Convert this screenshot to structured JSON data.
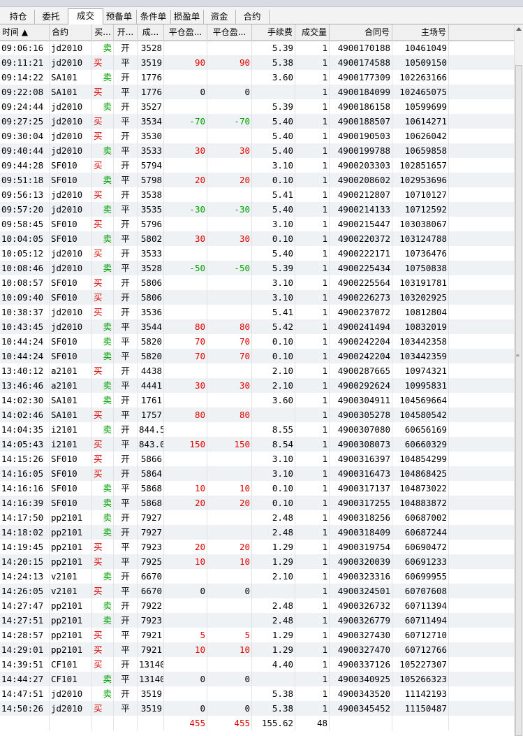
{
  "tabs": [
    "持仓",
    "委托",
    "成交",
    "预备单",
    "条件单",
    "损盈单",
    "资金",
    "合约"
  ],
  "active_tab": "成交",
  "columns": [
    "时间 ▲",
    "合约",
    "买...",
    "开...",
    "成...",
    "平仓盈...",
    "平仓盈...",
    "手续费",
    "成交量",
    "合同号",
    "主场号"
  ],
  "rows": [
    [
      "09:06:16",
      "jd2010",
      "卖",
      "开",
      "3528",
      "",
      "",
      "5.39",
      "1",
      "4900170188",
      "10461049"
    ],
    [
      "09:11:21",
      "jd2010",
      "买",
      "平",
      "3519",
      "90",
      "90",
      "5.38",
      "1",
      "4900174588",
      "10509150"
    ],
    [
      "09:14:22",
      "SA101",
      "卖",
      "开",
      "1776",
      "",
      "",
      "3.60",
      "1",
      "4900177309",
      "102263166"
    ],
    [
      "09:22:08",
      "SA101",
      "买",
      "平",
      "1776",
      "0",
      "0",
      "",
      "1",
      "4900184099",
      "102465075"
    ],
    [
      "09:24:44",
      "jd2010",
      "卖",
      "开",
      "3527",
      "",
      "",
      "5.39",
      "1",
      "4900186158",
      "10599699"
    ],
    [
      "09:27:25",
      "jd2010",
      "买",
      "平",
      "3534",
      "-70",
      "-70",
      "5.40",
      "1",
      "4900188507",
      "10614271"
    ],
    [
      "09:30:04",
      "jd2010",
      "买",
      "开",
      "3530",
      "",
      "",
      "5.40",
      "1",
      "4900190503",
      "10626042"
    ],
    [
      "09:40:44",
      "jd2010",
      "卖",
      "平",
      "3533",
      "30",
      "30",
      "5.40",
      "1",
      "4900199788",
      "10659858"
    ],
    [
      "09:44:28",
      "SF010",
      "买",
      "开",
      "5794",
      "",
      "",
      "3.10",
      "1",
      "4900203303",
      "102851657"
    ],
    [
      "09:51:18",
      "SF010",
      "卖",
      "平",
      "5798",
      "20",
      "20",
      "0.10",
      "1",
      "4900208602",
      "102953696"
    ],
    [
      "09:56:13",
      "jd2010",
      "买",
      "开",
      "3538",
      "",
      "",
      "5.41",
      "1",
      "4900212807",
      "10710127"
    ],
    [
      "09:57:20",
      "jd2010",
      "卖",
      "平",
      "3535",
      "-30",
      "-30",
      "5.40",
      "1",
      "4900214133",
      "10712592"
    ],
    [
      "09:58:45",
      "SF010",
      "买",
      "开",
      "5796",
      "",
      "",
      "3.10",
      "1",
      "4900215447",
      "103038067"
    ],
    [
      "10:04:05",
      "SF010",
      "卖",
      "平",
      "5802",
      "30",
      "30",
      "0.10",
      "1",
      "4900220372",
      "103124788"
    ],
    [
      "10:05:12",
      "jd2010",
      "买",
      "开",
      "3533",
      "",
      "",
      "5.40",
      "1",
      "4900222171",
      "10736476"
    ],
    [
      "10:08:46",
      "jd2010",
      "卖",
      "平",
      "3528",
      "-50",
      "-50",
      "5.39",
      "1",
      "4900225434",
      "10750838"
    ],
    [
      "10:08:57",
      "SF010",
      "买",
      "开",
      "5806",
      "",
      "",
      "3.10",
      "1",
      "4900225564",
      "103191781"
    ],
    [
      "10:09:40",
      "SF010",
      "买",
      "开",
      "5806",
      "",
      "",
      "3.10",
      "1",
      "4900226273",
      "103202925"
    ],
    [
      "10:38:37",
      "jd2010",
      "买",
      "开",
      "3536",
      "",
      "",
      "5.41",
      "1",
      "4900237072",
      "10812804"
    ],
    [
      "10:43:45",
      "jd2010",
      "卖",
      "平",
      "3544",
      "80",
      "80",
      "5.42",
      "1",
      "4900241494",
      "10832019"
    ],
    [
      "10:44:24",
      "SF010",
      "卖",
      "平",
      "5820",
      "70",
      "70",
      "0.10",
      "1",
      "4900242204",
      "103442358"
    ],
    [
      "10:44:24",
      "SF010",
      "卖",
      "平",
      "5820",
      "70",
      "70",
      "0.10",
      "1",
      "4900242204",
      "103442359"
    ],
    [
      "13:40:12",
      "a2101",
      "买",
      "开",
      "4438",
      "",
      "",
      "2.10",
      "1",
      "4900287665",
      "10974321"
    ],
    [
      "13:46:46",
      "a2101",
      "卖",
      "平",
      "4441",
      "30",
      "30",
      "2.10",
      "1",
      "4900292624",
      "10995831"
    ],
    [
      "14:02:30",
      "SA101",
      "卖",
      "开",
      "1761",
      "",
      "",
      "3.60",
      "1",
      "4900304911",
      "104569664"
    ],
    [
      "14:02:46",
      "SA101",
      "买",
      "平",
      "1757",
      "80",
      "80",
      "",
      "1",
      "4900305278",
      "104580542"
    ],
    [
      "14:04:35",
      "i2101",
      "卖",
      "开",
      "844.5",
      "",
      "",
      "8.55",
      "1",
      "4900307080",
      "60656169"
    ],
    [
      "14:05:43",
      "i2101",
      "买",
      "平",
      "843.0",
      "150",
      "150",
      "8.54",
      "1",
      "4900308073",
      "60660329"
    ],
    [
      "14:15:26",
      "SF010",
      "买",
      "开",
      "5866",
      "",
      "",
      "3.10",
      "1",
      "4900316397",
      "104854299"
    ],
    [
      "14:16:05",
      "SF010",
      "买",
      "开",
      "5864",
      "",
      "",
      "3.10",
      "1",
      "4900316473",
      "104868425"
    ],
    [
      "14:16:16",
      "SF010",
      "卖",
      "平",
      "5868",
      "10",
      "10",
      "0.10",
      "1",
      "4900317137",
      "104873022"
    ],
    [
      "14:16:39",
      "SF010",
      "卖",
      "平",
      "5868",
      "20",
      "20",
      "0.10",
      "1",
      "4900317255",
      "104883872"
    ],
    [
      "14:17:50",
      "pp2101",
      "卖",
      "开",
      "7927",
      "",
      "",
      "2.48",
      "1",
      "4900318256",
      "60687002"
    ],
    [
      "14:18:02",
      "pp2101",
      "卖",
      "开",
      "7927",
      "",
      "",
      "2.48",
      "1",
      "4900318409",
      "60687244"
    ],
    [
      "14:19:45",
      "pp2101",
      "买",
      "平",
      "7923",
      "20",
      "20",
      "1.29",
      "1",
      "4900319754",
      "60690472"
    ],
    [
      "14:20:15",
      "pp2101",
      "买",
      "平",
      "7925",
      "10",
      "10",
      "1.29",
      "1",
      "4900320039",
      "60691233"
    ],
    [
      "14:24:13",
      "v2101",
      "卖",
      "开",
      "6670",
      "",
      "",
      "2.10",
      "1",
      "4900323316",
      "60699955"
    ],
    [
      "14:26:05",
      "v2101",
      "买",
      "平",
      "6670",
      "0",
      "0",
      "",
      "1",
      "4900324501",
      "60707608"
    ],
    [
      "14:27:47",
      "pp2101",
      "卖",
      "开",
      "7922",
      "",
      "",
      "2.48",
      "1",
      "4900326732",
      "60711394"
    ],
    [
      "14:27:51",
      "pp2101",
      "卖",
      "开",
      "7923",
      "",
      "",
      "2.48",
      "1",
      "4900326779",
      "60711494"
    ],
    [
      "14:28:57",
      "pp2101",
      "买",
      "平",
      "7921",
      "5",
      "5",
      "1.29",
      "1",
      "4900327430",
      "60712710"
    ],
    [
      "14:29:01",
      "pp2101",
      "买",
      "平",
      "7921",
      "10",
      "10",
      "1.29",
      "1",
      "4900327470",
      "60712766"
    ],
    [
      "14:39:51",
      "CF101",
      "买",
      "开",
      "13140",
      "",
      "",
      "4.40",
      "1",
      "4900337126",
      "105227307"
    ],
    [
      "14:44:27",
      "CF101",
      "卖",
      "平",
      "13140",
      "0",
      "0",
      "",
      "1",
      "4900340925",
      "105266323"
    ],
    [
      "14:47:51",
      "jd2010",
      "卖",
      "开",
      "3519",
      "",
      "",
      "5.38",
      "1",
      "4900343520",
      "11142193"
    ],
    [
      "14:50:26",
      "jd2010",
      "买",
      "平",
      "3519",
      "0",
      "0",
      "5.38",
      "1",
      "4900345452",
      "11150487"
    ]
  ],
  "totals": {
    "pnl1": "455",
    "pnl2": "455",
    "fee": "155.62",
    "qty": "48"
  },
  "colors": {
    "buy": "#e00000",
    "sell": "#00a000",
    "profit": "#e00000",
    "loss": "#00a000"
  }
}
